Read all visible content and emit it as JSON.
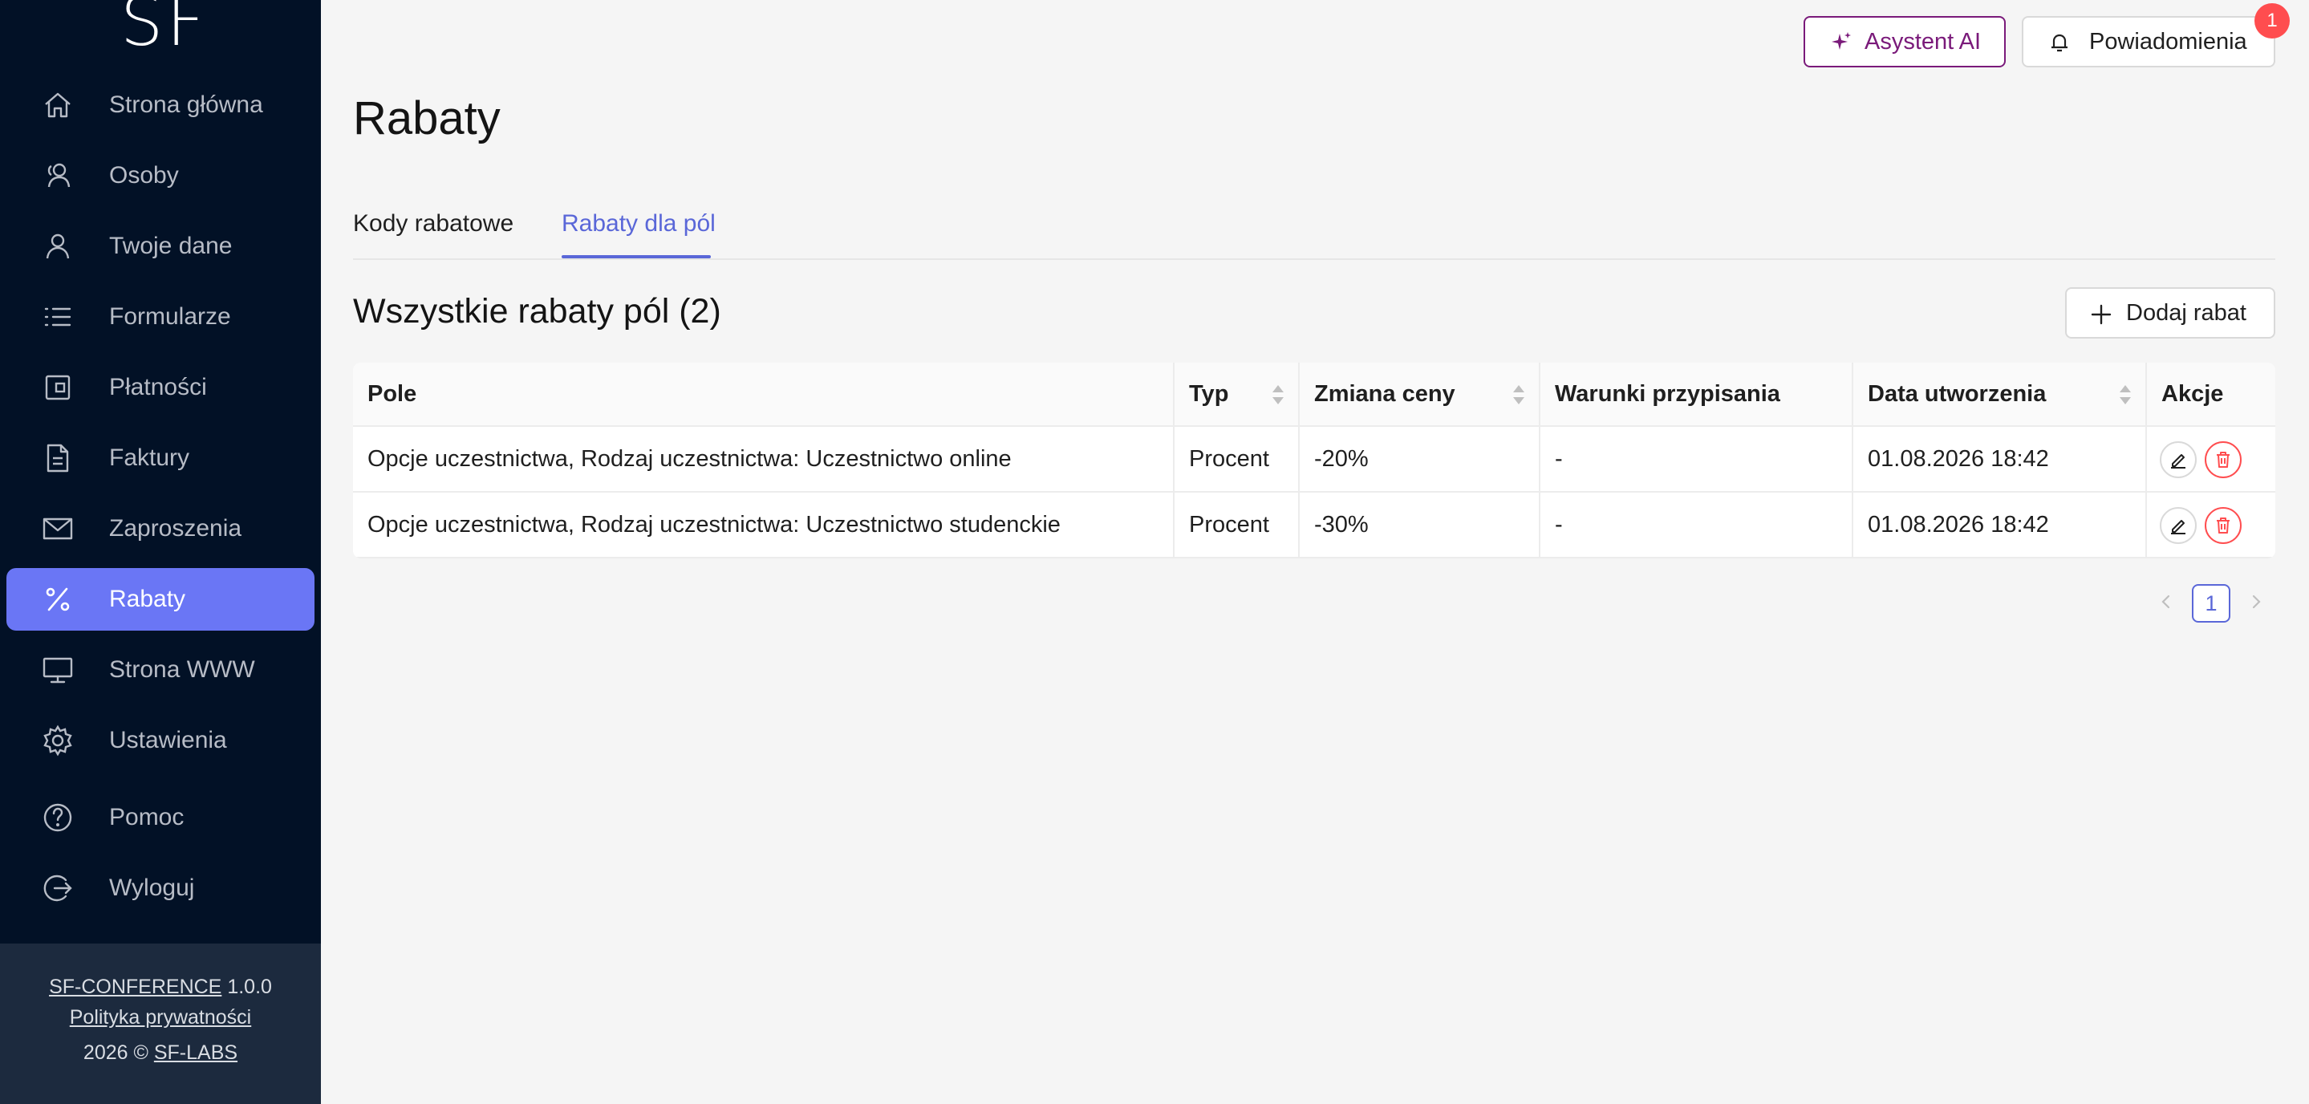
{
  "sidebar": {
    "logo": "SF",
    "items": [
      {
        "label": "Strona główna",
        "icon": "home-icon"
      },
      {
        "label": "Osoby",
        "icon": "people-icon"
      },
      {
        "label": "Twoje dane",
        "icon": "user-icon"
      },
      {
        "label": "Formularze",
        "icon": "list-icon"
      },
      {
        "label": "Płatności",
        "icon": "wallet-icon"
      },
      {
        "label": "Faktury",
        "icon": "document-icon"
      },
      {
        "label": "Zaproszenia",
        "icon": "envelope-icon"
      },
      {
        "label": "Rabaty",
        "icon": "percent-icon",
        "active": true
      },
      {
        "label": "Strona WWW",
        "icon": "monitor-icon"
      },
      {
        "label": "Ustawienia",
        "icon": "gear-icon"
      },
      {
        "label": "Pomoc",
        "icon": "question-icon"
      },
      {
        "label": "Wyloguj",
        "icon": "logout-icon"
      }
    ],
    "footer": {
      "app_name": "SF-CONFERENCE",
      "version": "1.0.0",
      "privacy": "Polityka prywatności",
      "copyright": "2026 ©",
      "company": "SF-LABS"
    }
  },
  "header": {
    "ai_button": "Asystent AI",
    "notifications_button": "Powiadomienia",
    "notifications_count": "1"
  },
  "page": {
    "title": "Rabaty",
    "tabs": [
      {
        "label": "Kody rabatowe",
        "active": false
      },
      {
        "label": "Rabaty dla pól",
        "active": true
      }
    ],
    "section_title": "Wszystkie rabaty pól (2)",
    "add_button": "Dodaj rabat"
  },
  "table": {
    "columns": [
      "Pole",
      "Typ",
      "Zmiana ceny",
      "Warunki przypisania",
      "Data utworzenia",
      "Akcje"
    ],
    "rows": [
      {
        "pole": "Opcje uczestnictwa, Rodzaj uczestnictwa: Uczestnictwo online",
        "typ": "Procent",
        "zmiana": "-20%",
        "warunki": "-",
        "data": "01.08.2026 18:42"
      },
      {
        "pole": "Opcje uczestnictwa, Rodzaj uczestnictwa: Uczestnictwo studenckie",
        "typ": "Procent",
        "zmiana": "-30%",
        "warunki": "-",
        "data": "01.08.2026 18:42"
      }
    ]
  },
  "pagination": {
    "current": "1"
  },
  "colors": {
    "sidebar_bg": "#021126",
    "active_item": "#6a76f5",
    "accent": "#5a67d8",
    "ai_border": "#7a1a7a",
    "danger": "#ff4d4f"
  }
}
